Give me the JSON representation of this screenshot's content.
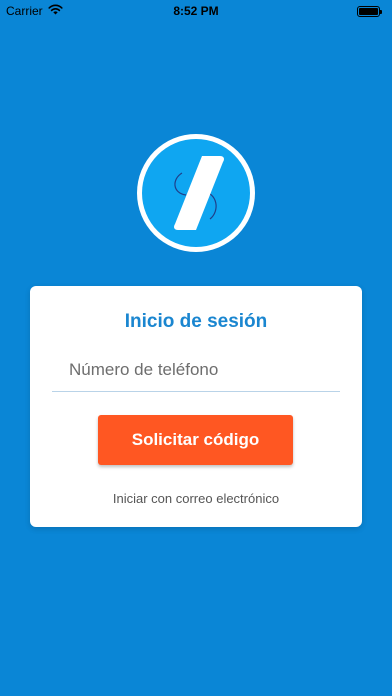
{
  "status_bar": {
    "carrier": "Carrier",
    "time": "8:52 PM"
  },
  "colors": {
    "background": "#0A86D6",
    "logo_circle": "#0FA6F1",
    "title": "#1A86D0",
    "primary_button": "#FF5722"
  },
  "icons": {
    "wifi": "wifi-icon",
    "battery": "battery-icon",
    "logo": "app-logo"
  },
  "login": {
    "title": "Inicio de sesión",
    "phone_placeholder": "Número de teléfono",
    "phone_value": "",
    "submit_label": "Solicitar código",
    "email_link": "Iniciar con correo electrónico"
  }
}
